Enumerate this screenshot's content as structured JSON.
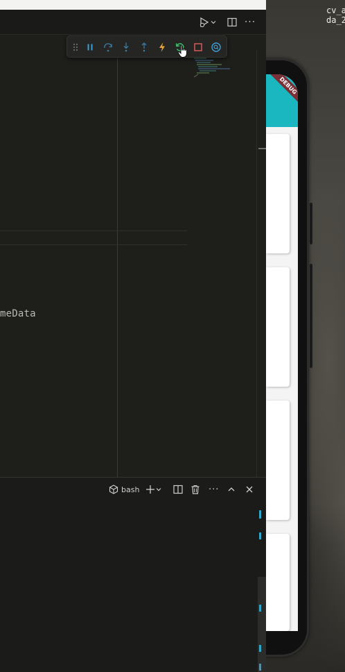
{
  "editor": {
    "code_fragment": "meData"
  },
  "panel": {
    "terminal_shell": "bash",
    "more_label": "···"
  },
  "titlebar": {
    "more_label": "···"
  },
  "desktop": {
    "label": "cv_a\nda_2"
  },
  "emulator": {
    "debug_banner": "DEBUG",
    "app_bar_color": "#1ab7c0"
  },
  "debug_toolbar": {
    "buttons": [
      "gripper-icon",
      "pause-icon",
      "step-over-icon",
      "step-into-icon",
      "step-out-icon",
      "hot-reload-icon",
      "hot-restart-icon",
      "stop-icon",
      "devtools-icon"
    ],
    "colors": {
      "pause": "#3c9fd6",
      "step": "#3a7ea8",
      "hot_reload": "#e5a23a",
      "hot_restart": "#3fbf6a",
      "stop": "#e25c5c",
      "devtools": "#3c9fd6"
    }
  }
}
